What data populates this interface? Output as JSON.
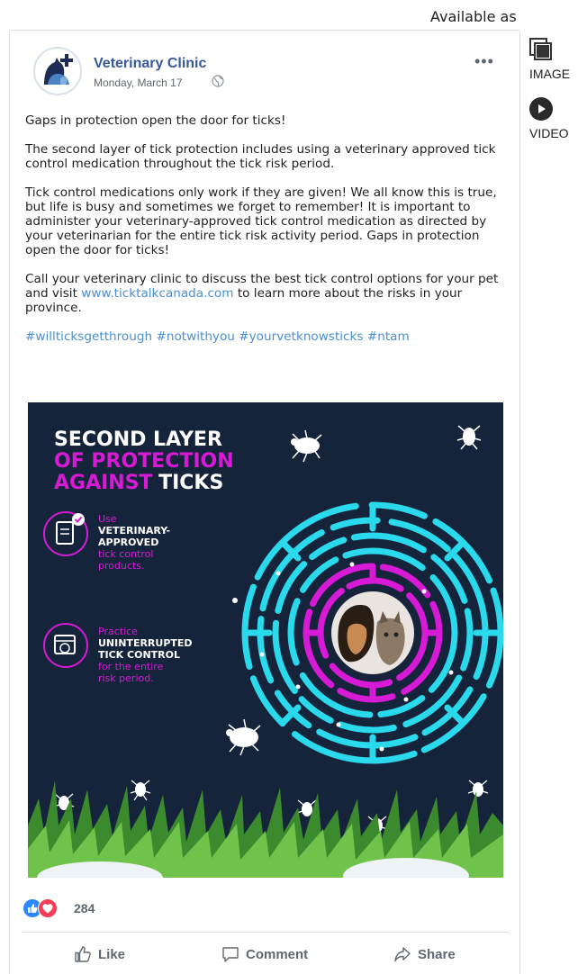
{
  "available_as": "Available as",
  "side_options": [
    {
      "label": "IMAGE",
      "icon": "image-stack-icon"
    },
    {
      "label": "VIDEO",
      "icon": "play-circle-icon"
    }
  ],
  "post": {
    "page_name": "Veterinary Clinic",
    "date": "Monday, March 17",
    "paragraphs": [
      "Gaps in protection open the door for ticks!",
      "The second layer of tick protection includes using a veterinary approved tick control medication throughout the tick risk period.",
      "Tick control medications only work if they are given! We all know this is true, but life is busy and sometimes we forget to remember! It is important to administer your veterinary-approved tick control medication as directed by your veterinarian for the entire tick risk activity period. Gaps in protection open the door for ticks!"
    ],
    "call_text_before": "Call your veterinary clinic to discuss the best tick control options for your pet and visit ",
    "link": "www.ticktalkcanada.com",
    "call_text_after": " to learn more about the risks in your province.",
    "hashtags": [
      "#willticksgetthrough",
      "#notwithyou",
      "#yourvetknowsticks",
      "#ntam"
    ]
  },
  "graphic": {
    "title_line1": "SECOND LAYER",
    "title_line2": "OF PROTECTION",
    "title_line3a": "AGAINST",
    "title_line3b": "TICKS",
    "item1_use": "Use",
    "item1_bold1": "VETERINARY-",
    "item1_bold2": "APPROVED",
    "item1_rest1": "tick control",
    "item1_rest2": "products.",
    "item2_use": "Practice",
    "item2_bold1": "UNINTERRUPTED",
    "item2_bold2": "TICK CONTROL",
    "item2_rest1": "for the entire",
    "item2_rest2": "risk period."
  },
  "reactions": {
    "count": "284"
  },
  "actions": {
    "like": "Like",
    "comment": "Comment",
    "share": "Share"
  },
  "colors": {
    "link": "#4b8fd0",
    "page_name": "#385898",
    "magenta": "#d61ad6",
    "cyan": "#2bd9ec",
    "navy": "#16243b"
  }
}
